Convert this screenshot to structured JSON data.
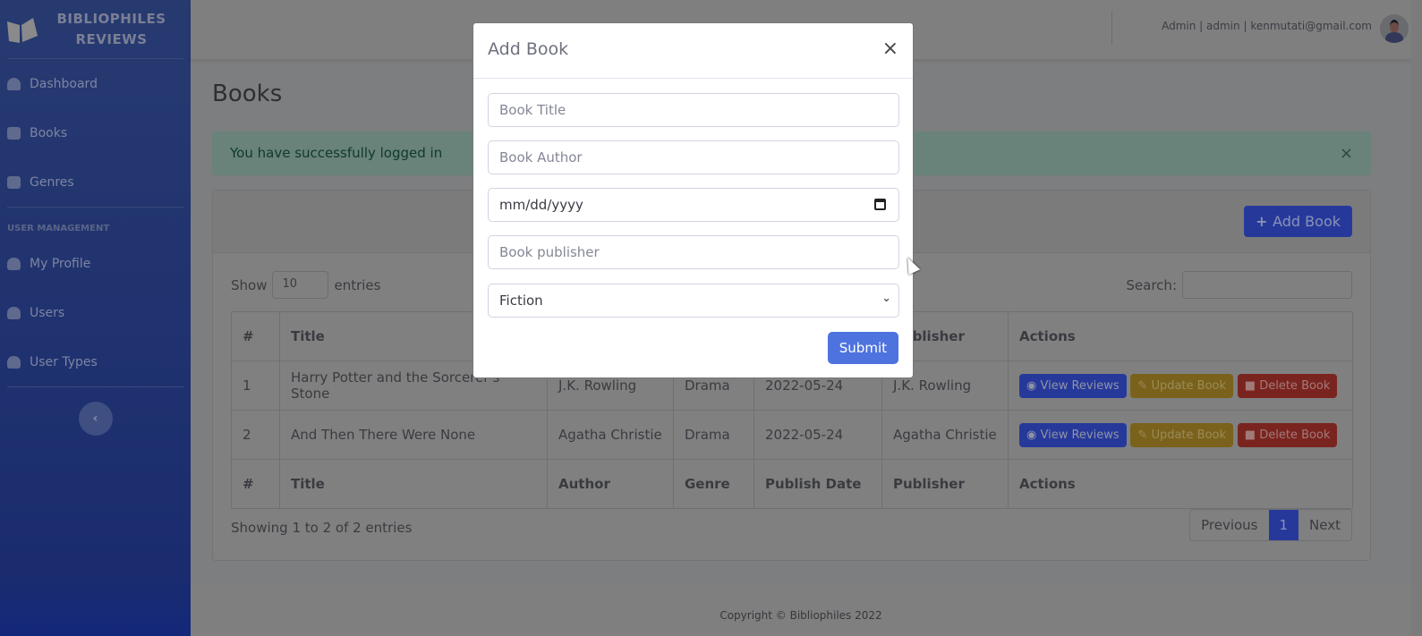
{
  "sidebar": {
    "brand_line1": "BIBLIOPHILES",
    "brand_line2": "REVIEWS",
    "items": [
      {
        "label": "Dashboard",
        "icon": "tachometer-icon"
      },
      {
        "label": "Books",
        "icon": "book-icon"
      },
      {
        "label": "Genres",
        "icon": "address-book-icon"
      }
    ],
    "section": "USER MANAGEMENT",
    "user_items": [
      {
        "label": "My Profile",
        "icon": "user-icon"
      },
      {
        "label": "Users",
        "icon": "users-icon"
      },
      {
        "label": "User Types",
        "icon": "user-plus-icon"
      }
    ],
    "toggle": "‹"
  },
  "topbar": {
    "user": "Admin | admin | kenmutati@gmail.com"
  },
  "page": {
    "title": "Books",
    "alert": "You have successfully logged in",
    "alert_close": "×",
    "add_book": "Add Book",
    "show": "Show",
    "entries_value": "10",
    "entries": "entries",
    "search_label": "Search:",
    "info": "Showing 1 to 2 of 2 entries",
    "prev": "Previous",
    "page": "1",
    "next": "Next"
  },
  "table": {
    "headers": [
      "#",
      "Title",
      "Author",
      "Genre",
      "Publish Date",
      "Publisher",
      "Actions"
    ],
    "rows": [
      [
        "1",
        "Harry Potter and the Sorcerer's Stone",
        "J.K. Rowling",
        "Drama",
        "2022-05-24",
        "J.K. Rowling"
      ],
      [
        "2",
        "And Then There Were None",
        "Agatha Christie",
        "Drama",
        "2022-05-24",
        "Agatha Christie"
      ]
    ],
    "actions": {
      "view": "View Reviews",
      "update": "Update Book",
      "delete": "Delete Book"
    }
  },
  "modal": {
    "title": "Add Book",
    "close": "×",
    "title_placeholder": "Book Title",
    "author_placeholder": "Book Author",
    "date_placeholder": "mm/dd/yyyy",
    "publisher_placeholder": "Book publisher",
    "genre_value": "Fiction",
    "submit": "Submit"
  },
  "footer": {
    "text": "Copyright © Bibliophiles 2022"
  },
  "colors": {
    "primary": "#4e73df",
    "success": "#1cc88a",
    "warning": "#f6c23e",
    "danger": "#e74a3b"
  }
}
